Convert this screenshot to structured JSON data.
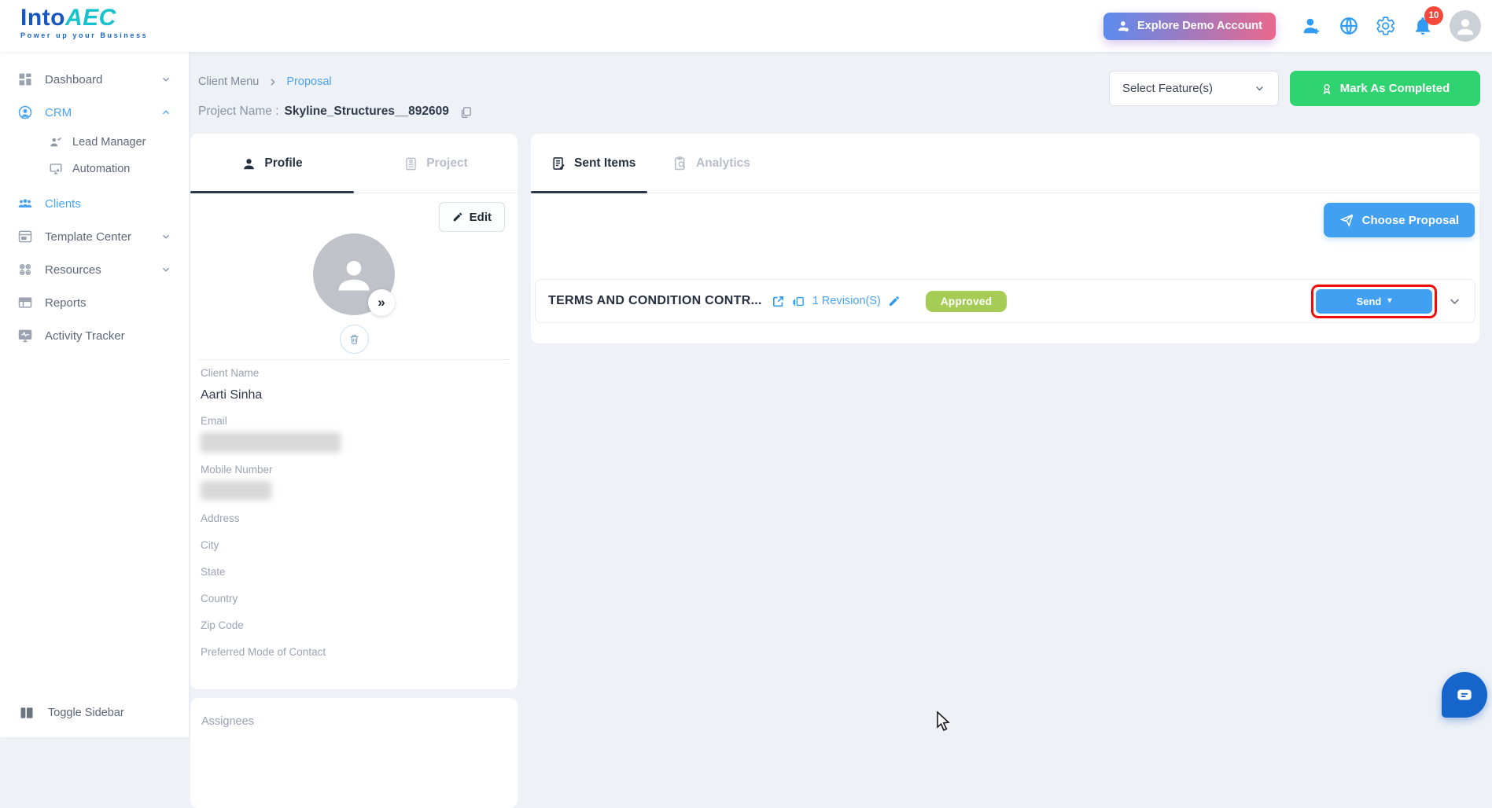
{
  "header": {
    "logo": {
      "part1": "Into",
      "part2": "AEC",
      "tagline": "Power up your Business"
    },
    "explore_button_label": "Explore Demo Account",
    "notification_count": "10"
  },
  "sidebar": {
    "items": [
      {
        "label": "Dashboard"
      },
      {
        "label": "CRM"
      },
      {
        "label": "Lead Manager"
      },
      {
        "label": "Automation"
      },
      {
        "label": "Clients"
      },
      {
        "label": "Template Center"
      },
      {
        "label": "Resources"
      },
      {
        "label": "Reports"
      },
      {
        "label": "Activity Tracker"
      }
    ],
    "toggle_label": "Toggle Sidebar"
  },
  "breadcrumb": {
    "parent": "Client Menu",
    "current": "Proposal"
  },
  "project": {
    "label": "Project Name :",
    "name": "Skyline_Structures__892609"
  },
  "toolbar": {
    "feature_select_value": "Select Feature(s)",
    "mark_completed_label": "Mark As Completed"
  },
  "profile_card": {
    "tabs": {
      "profile": "Profile",
      "project": "Project"
    },
    "edit_label": "Edit",
    "avatar_chevron": "»",
    "fields": [
      {
        "label": "Client Name",
        "value": "Aarti Sinha"
      },
      {
        "label": "Email"
      },
      {
        "label": "Mobile Number"
      },
      {
        "label": "Address"
      },
      {
        "label": "City"
      },
      {
        "label": "State"
      },
      {
        "label": "Country"
      },
      {
        "label": "Zip Code"
      },
      {
        "label": "Preferred Mode of Contact"
      }
    ]
  },
  "assignees_card": {
    "title": "Assignees"
  },
  "sent_panel": {
    "tabs": {
      "sent": "Sent Items",
      "analytics": "Analytics"
    },
    "choose_proposal_label": "Choose Proposal",
    "proposal": {
      "title": "TERMS AND CONDITION CONTR...",
      "revisions": "1 Revision(S)",
      "status": "Approved",
      "send_label": "Send",
      "send_caret": "▾"
    }
  },
  "colors": {
    "accent_blue": "#42a0f2",
    "link_blue": "#4da3f5",
    "success_green": "#2fd36f",
    "approved_badge_green": "#a5cd55",
    "notification_red": "#f4483a",
    "highlight_red": "#f10c0c",
    "explore_gradient_start": "#5b8bef",
    "explore_gradient_end": "#e9688c",
    "logo_blue": "#1757c1",
    "logo_teal": "#15c2cd",
    "chat_blue": "#1565cb"
  }
}
